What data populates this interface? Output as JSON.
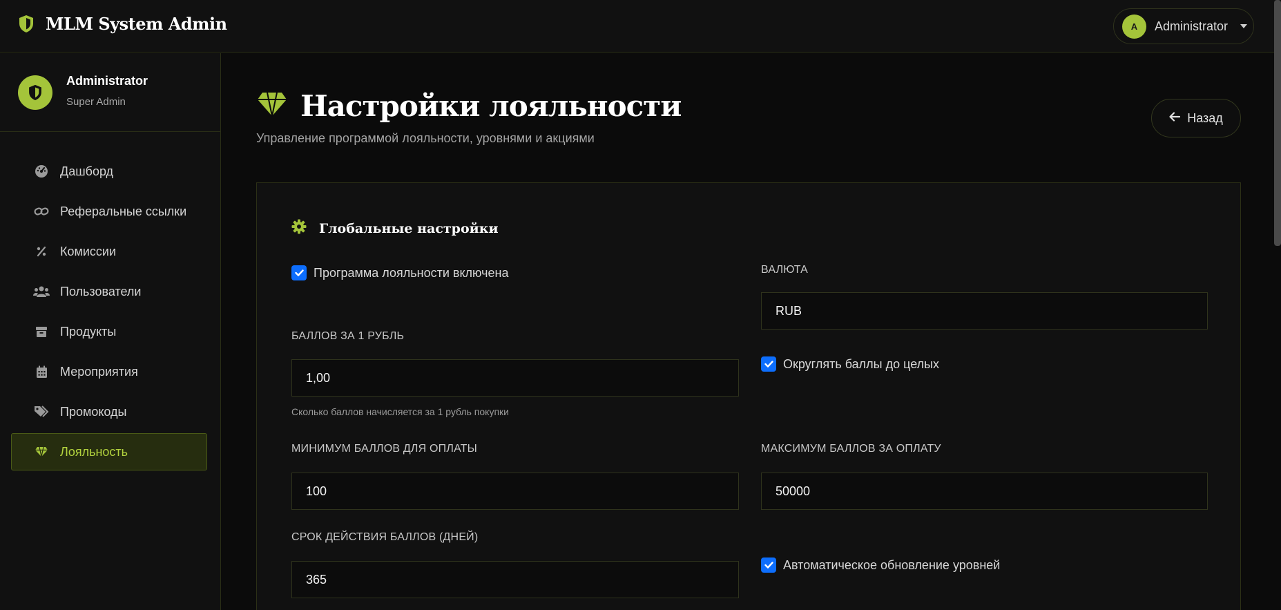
{
  "app": {
    "title": "MLM System Admin"
  },
  "topbar": {
    "user_initial": "A",
    "user_name": "Administrator"
  },
  "sidebar": {
    "profile": {
      "name": "Administrator",
      "role": "Super Admin"
    },
    "items": [
      {
        "label": "Дашборд",
        "icon": "dashboard-gauge-icon"
      },
      {
        "label": "Реферальные ссылки",
        "icon": "link-icon"
      },
      {
        "label": "Комиссии",
        "icon": "percent-icon"
      },
      {
        "label": "Пользователи",
        "icon": "users-icon"
      },
      {
        "label": "Продукты",
        "icon": "box-icon"
      },
      {
        "label": "Мероприятия",
        "icon": "calendar-icon"
      },
      {
        "label": "Промокоды",
        "icon": "tags-icon"
      },
      {
        "label": "Лояльность",
        "icon": "gem-icon",
        "active": true
      }
    ]
  },
  "page": {
    "title": "Настройки лояльности",
    "subtitle": "Управление программой лояльности, уровнями и акциями",
    "back_label": "Назад"
  },
  "global_settings": {
    "title": "Глобальные настройки",
    "program_enabled_label": "Программа лояльности включена",
    "program_enabled": true,
    "currency_label": "ВАЛЮТА",
    "currency_value": "RUB",
    "points_per_ruble_label": "БАЛЛОВ ЗА 1 РУБЛЬ",
    "points_per_ruble_value": "1,00",
    "points_per_ruble_help": "Сколько баллов начисляется за 1 рубль покупки",
    "round_points_label": "Округлять баллы до целых",
    "round_points": true,
    "min_points_label": "МИНИМУМ БАЛЛОВ ДЛЯ ОПЛАТЫ",
    "min_points_value": "100",
    "max_points_label": "МАКСИМУМ БАЛЛОВ ЗА ОПЛАТУ",
    "max_points_value": "50000",
    "expiry_label": "СРОК ДЕЙСТВИЯ БАЛЛОВ (ДНЕЙ)",
    "expiry_value": "365",
    "auto_levels_label": "Автоматическое обновление уровней",
    "auto_levels": true
  },
  "colors": {
    "accent": "#a4c43a",
    "checkbox": "#0d6efd",
    "background": "#0b0b0b",
    "panel": "#111111"
  }
}
